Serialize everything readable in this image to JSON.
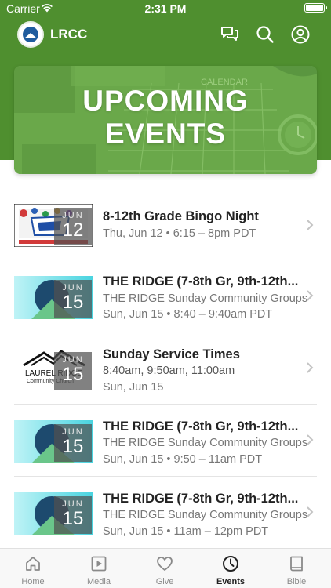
{
  "status_bar": {
    "carrier": "Carrier",
    "time": "2:31 PM"
  },
  "header": {
    "app_name": "LRCC",
    "icons": [
      "chat-icon",
      "search-icon",
      "profile-icon"
    ]
  },
  "banner": {
    "title_line1": "UPCOMING",
    "title_line2": "EVENTS",
    "calendar_label": "CALENDAR"
  },
  "colors": {
    "brand_green": "#4f8f2f",
    "banner_green": "#6aa84a",
    "date_overlay": "#505050"
  },
  "events": [
    {
      "title": "8-12th Grade Bingo Night",
      "line1": "Thu, Jun 12 • 6:15 – 8pm PDT",
      "line2": "",
      "month": "JUN",
      "day": "12",
      "thumb": "bingo-night-image"
    },
    {
      "title": "THE RIDGE (7-8th Gr, 9th-12th...",
      "line1": "THE RIDGE Sunday Community Groups",
      "line2": "Sun, Jun 15 • 8:40 – 9:40am PDT",
      "month": "JUN",
      "day": "15",
      "thumb": "the-ridge-image"
    },
    {
      "title": "Sunday Service Times",
      "line1": "8:40am, 9:50am, 11:00am",
      "line2": "Sun, Jun 15",
      "month": "JUN",
      "day": "15",
      "thumb": "laurel-ridge-logo",
      "logo_line1": "LAUREL RIDGE",
      "logo_line2": "Community Church"
    },
    {
      "title": "THE RIDGE (7-8th Gr, 9th-12th...",
      "line1": "THE RIDGE Sunday Community Groups",
      "line2": "Sun, Jun 15 • 9:50 – 11am PDT",
      "month": "JUN",
      "day": "15",
      "thumb": "the-ridge-image"
    },
    {
      "title": "THE RIDGE (7-8th Gr, 9th-12th...",
      "line1": "THE RIDGE Sunday Community Groups",
      "line2": "Sun, Jun 15 • 11am – 12pm PDT",
      "month": "JUN",
      "day": "15",
      "thumb": "the-ridge-image"
    }
  ],
  "tabs": [
    {
      "label": "Home",
      "icon": "home-icon",
      "active": false
    },
    {
      "label": "Media",
      "icon": "media-icon",
      "active": false
    },
    {
      "label": "Give",
      "icon": "heart-icon",
      "active": false
    },
    {
      "label": "Events",
      "icon": "clock-icon",
      "active": true
    },
    {
      "label": "Bible",
      "icon": "book-icon",
      "active": false
    }
  ]
}
